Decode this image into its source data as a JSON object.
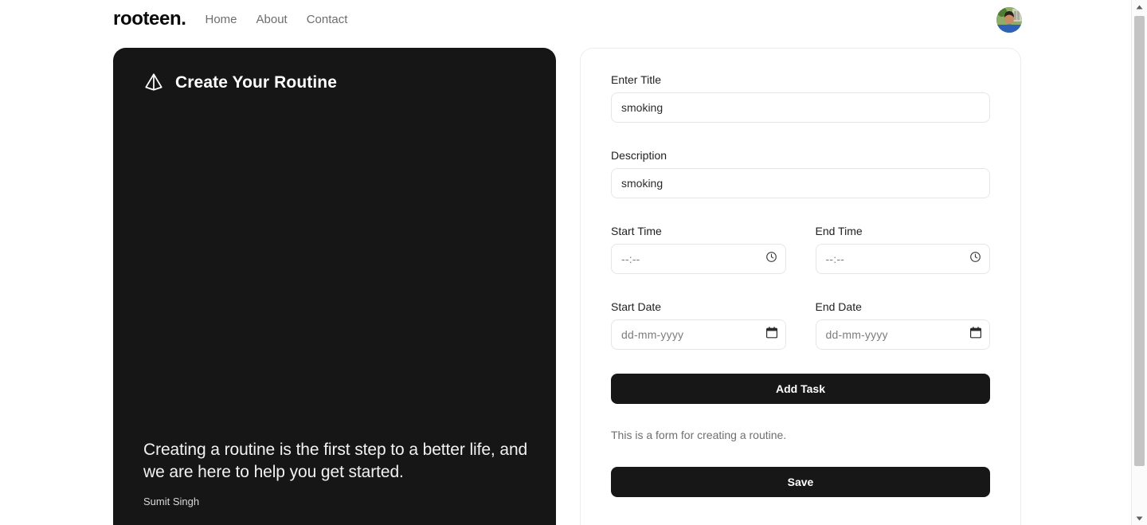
{
  "navbar": {
    "brand": "rooteen.",
    "links": [
      {
        "label": "Home",
        "name": "nav-link-home"
      },
      {
        "label": "About",
        "name": "nav-link-about"
      },
      {
        "label": "Contact",
        "name": "nav-link-contact"
      }
    ],
    "avatar_icon": "user-avatar-photo"
  },
  "left_panel": {
    "logo_icon": "triangle-prism-logo-icon",
    "title": "Create Your Routine",
    "quote": "Creating a routine is the first step to a better life, and we are here to help you get started.",
    "author": "Sumit Singh",
    "background_color": "#161616"
  },
  "form": {
    "title_field": {
      "label": "Enter Title",
      "value": "smoking",
      "placeholder": "Enter Title"
    },
    "description_field": {
      "label": "Description",
      "value": "smoking",
      "placeholder": "Description"
    },
    "start_time": {
      "label": "Start Time",
      "value": "--:--",
      "icon": "clock-icon"
    },
    "end_time": {
      "label": "End Time",
      "value": "--:--",
      "icon": "clock-icon"
    },
    "start_date": {
      "label": "Start Date",
      "value": "dd-mm-yyyy",
      "icon": "calendar-icon"
    },
    "end_date": {
      "label": "End Date",
      "value": "dd-mm-yyyy",
      "icon": "calendar-icon"
    },
    "add_task_label": "Add Task",
    "note": "This is a form for creating a routine.",
    "save_label": "Save",
    "button_color": "#171717"
  },
  "scrollbar": {
    "up_icon": "scroll-up-arrow-icon",
    "down_icon": "scroll-down-arrow-icon",
    "thumb": "scrollbar-thumb"
  }
}
